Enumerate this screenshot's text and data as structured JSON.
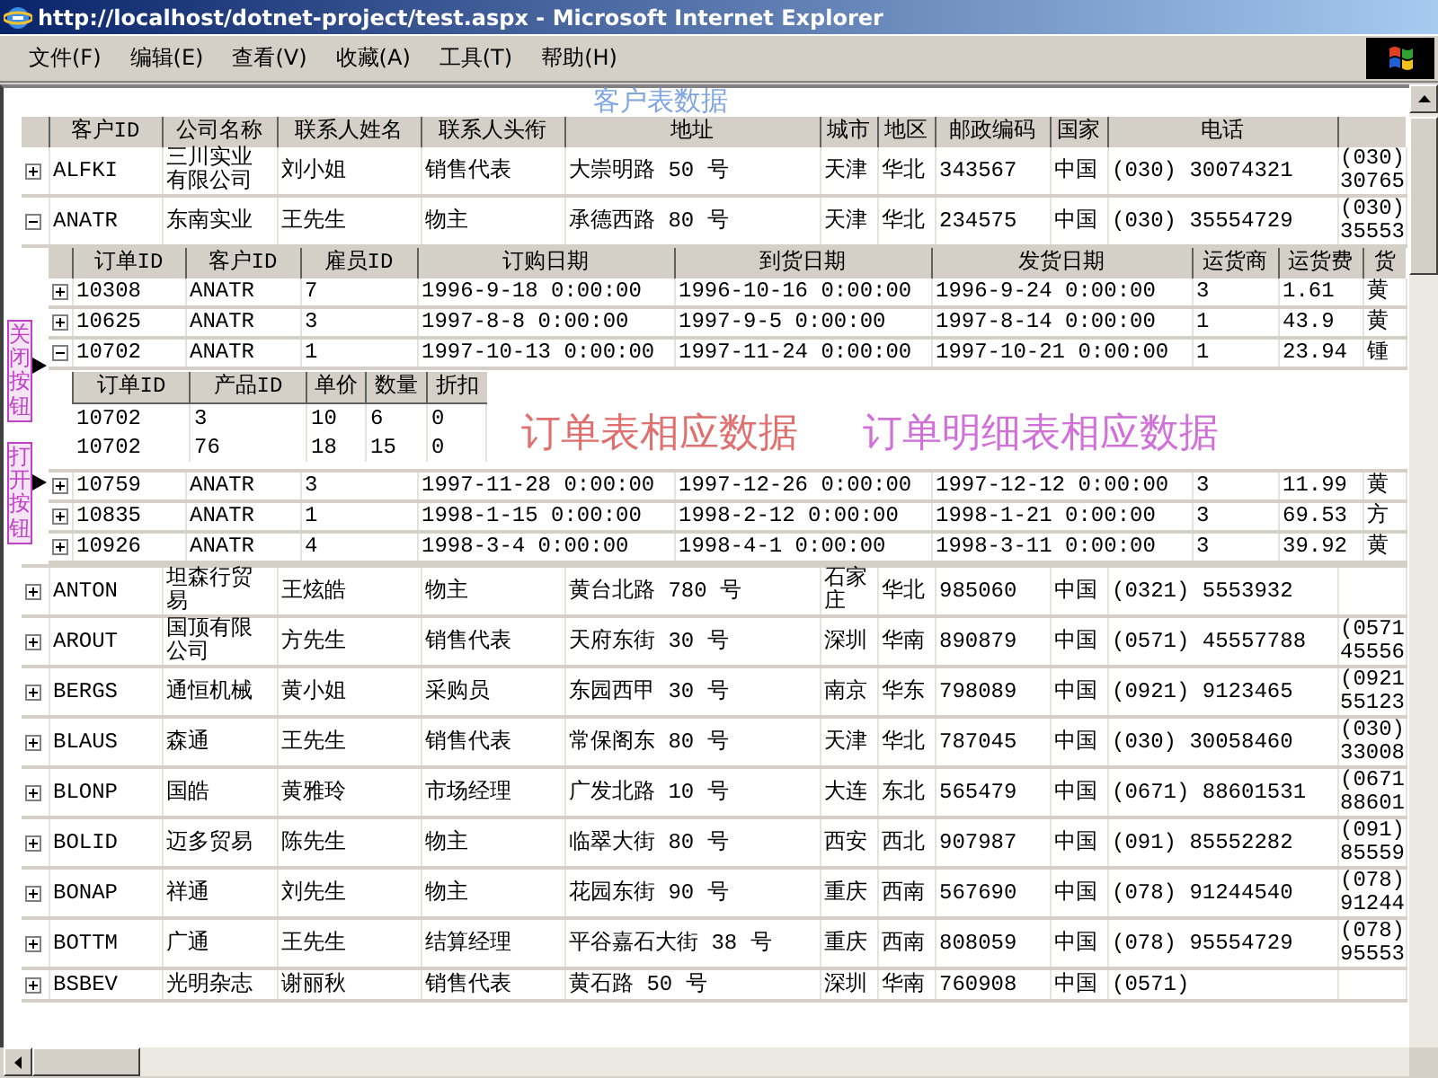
{
  "window": {
    "title": "http://localhost/dotnet-project/test.aspx - Microsoft Internet Explorer"
  },
  "menu": [
    "文件(F)",
    "编辑(E)",
    "查看(V)",
    "收藏(A)",
    "工具(T)",
    "帮助(H)"
  ],
  "customers": {
    "columns": [
      "客户ID",
      "公司名称",
      "联系人姓名",
      "联系人头衔",
      "地址",
      "城市",
      "地区",
      "邮政编码",
      "国家",
      "电话"
    ],
    "rows": [
      {
        "expanded": false,
        "cells": [
          "ALFKI",
          "三川实业有限公司",
          "刘小姐",
          "销售代表",
          "大崇明路 50 号",
          "天津",
          "华北",
          "343567",
          "中国",
          "(030) 30074321",
          "(030) 30765"
        ]
      },
      {
        "expanded": true,
        "cells": [
          "ANATR",
          "东南实业",
          "王先生",
          "物主",
          "承德西路 80 号",
          "天津",
          "华北",
          "234575",
          "中国",
          "(030) 35554729",
          "(030) 35553"
        ],
        "orders": {
          "columns": [
            "订单ID",
            "客户ID",
            "雇员ID",
            "订购日期",
            "到货日期",
            "发货日期",
            "运货商",
            "运货费",
            "货"
          ],
          "rows": [
            {
              "expanded": false,
              "cells": [
                "10308",
                "ANATR",
                "7",
                "1996-9-18 0:00:00",
                "1996-10-16 0:00:00",
                "1996-9-24 0:00:00",
                "3",
                "1.61",
                "黄"
              ]
            },
            {
              "expanded": false,
              "cells": [
                "10625",
                "ANATR",
                "3",
                "1997-8-8 0:00:00",
                "1997-9-5 0:00:00",
                "1997-8-14 0:00:00",
                "1",
                "43.9",
                "黄"
              ]
            },
            {
              "expanded": true,
              "cells": [
                "10702",
                "ANATR",
                "1",
                "1997-10-13 0:00:00",
                "1997-11-24 0:00:00",
                "1997-10-21 0:00:00",
                "1",
                "23.94",
                "锺"
              ],
              "details": {
                "columns": [
                  "订单ID",
                  "产品ID",
                  "单价",
                  "数量",
                  "折扣"
                ],
                "rows": [
                  [
                    "10702",
                    "3",
                    "10",
                    "6",
                    "0"
                  ],
                  [
                    "10702",
                    "76",
                    "18",
                    "15",
                    "0"
                  ]
                ]
              }
            },
            {
              "expanded": false,
              "cells": [
                "10759",
                "ANATR",
                "3",
                "1997-11-28 0:00:00",
                "1997-12-26 0:00:00",
                "1997-12-12 0:00:00",
                "3",
                "11.99",
                "黄"
              ]
            },
            {
              "expanded": false,
              "cells": [
                "10835",
                "ANATR",
                "1",
                "1998-1-15 0:00:00",
                "1998-2-12 0:00:00",
                "1998-1-21 0:00:00",
                "3",
                "69.53",
                "方"
              ]
            },
            {
              "expanded": false,
              "cells": [
                "10926",
                "ANATR",
                "4",
                "1998-3-4 0:00:00",
                "1998-4-1 0:00:00",
                "1998-3-11 0:00:00",
                "3",
                "39.92",
                "黄"
              ]
            }
          ]
        }
      },
      {
        "expanded": false,
        "cells": [
          "ANTON",
          "坦森行贸易",
          "王炫皓",
          "物主",
          "黄台北路 780 号",
          "石家庄",
          "华北",
          "985060",
          "中国",
          "(0321) 5553932"
        ]
      },
      {
        "expanded": false,
        "cells": [
          "AROUT",
          "国顶有限公司",
          "方先生",
          "销售代表",
          "天府东街 30 号",
          "深圳",
          "华南",
          "890879",
          "中国",
          "(0571) 45557788",
          "(0571 45556"
        ]
      },
      {
        "expanded": false,
        "cells": [
          "BERGS",
          "通恒机械",
          "黄小姐",
          "采购员",
          "东园西甲 30 号",
          "南京",
          "华东",
          "798089",
          "中国",
          "(0921) 9123465",
          "(0921 55123"
        ]
      },
      {
        "expanded": false,
        "cells": [
          "BLAUS",
          "森通",
          "王先生",
          "销售代表",
          "常保阁东 80 号",
          "天津",
          "华北",
          "787045",
          "中国",
          "(030) 30058460",
          "(030) 33008"
        ]
      },
      {
        "expanded": false,
        "cells": [
          "BLONP",
          "国皓",
          "黄雅玲",
          "市场经理",
          "广发北路 10 号",
          "大连",
          "东北",
          "565479",
          "中国",
          "(0671) 88601531",
          "(0671 88601"
        ]
      },
      {
        "expanded": false,
        "cells": [
          "BOLID",
          "迈多贸易",
          "陈先生",
          "物主",
          "临翠大街 80 号",
          "西安",
          "西北",
          "907987",
          "中国",
          "(091) 85552282",
          "(091) 85559"
        ]
      },
      {
        "expanded": false,
        "cells": [
          "BONAP",
          "祥通",
          "刘先生",
          "物主",
          "花园东街 90 号",
          "重庆",
          "西南",
          "567690",
          "中国",
          "(078) 91244540",
          "(078) 91244"
        ]
      },
      {
        "expanded": false,
        "cells": [
          "BOTTM",
          "广通",
          "王先生",
          "结算经理",
          "平谷嘉石大街 38 号",
          "重庆",
          "西南",
          "808059",
          "中国",
          "(078) 95554729",
          "(078) 95553"
        ]
      },
      {
        "expanded": false,
        "cells": [
          "BSBEV",
          "光明杂志",
          "谢丽秋",
          "销售代表",
          "黄石路 50 号",
          "深圳",
          "华南",
          "760908",
          "中国",
          "(0571)"
        ]
      }
    ]
  },
  "annotations": [
    {
      "kind": "caption",
      "text": "客户表数据",
      "color": "#7fa6e0"
    },
    {
      "kind": "caption",
      "text": "订单表相应数据",
      "color": "#e07070"
    },
    {
      "kind": "caption",
      "text": "订单明细表相应数据",
      "color": "#d070d8"
    },
    {
      "kind": "tag",
      "text": "关闭按钮",
      "color": "#c040c8"
    },
    {
      "kind": "tag",
      "text": "打开按钮",
      "color": "#c040c8"
    }
  ]
}
